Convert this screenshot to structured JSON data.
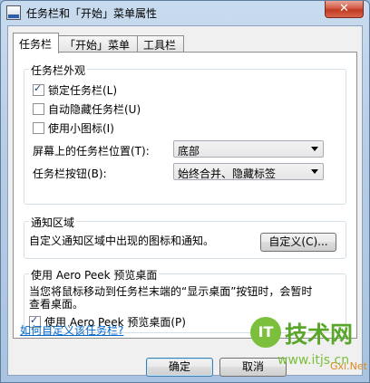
{
  "window": {
    "title": "任务栏和「开始」菜单属性",
    "close_label": "✕"
  },
  "tabs": [
    {
      "label": "任务栏",
      "active": true
    },
    {
      "label": "「开始」菜单",
      "active": false
    },
    {
      "label": "工具栏",
      "active": false
    }
  ],
  "appearance": {
    "group_label": "任务栏外观",
    "lock_taskbar": {
      "label": "锁定任务栏(L)",
      "checked": true
    },
    "autohide": {
      "label": "自动隐藏任务栏(U)",
      "checked": false
    },
    "small_icons": {
      "label": "使用小图标(I)",
      "checked": false
    },
    "location_label": "屏幕上的任务栏位置(T):",
    "location_value": "底部",
    "buttons_label": "任务栏按钮(B):",
    "buttons_value": "始终合并、隐藏标签"
  },
  "notification": {
    "group_label": "通知区域",
    "description": "自定义通知区域中出现的图标和通知。",
    "customize_button": "自定义(C)..."
  },
  "aero_peek": {
    "group_label": "使用 Aero Peek 预览桌面",
    "description_line1": "当您将鼠标移动到任务栏末端的“显示桌面”按钮时，会暂时",
    "description_line2": "查看桌面。",
    "checkbox": {
      "label": "使用 Aero Peek 预览桌面(P)",
      "checked": true
    }
  },
  "help_link": "如何自定义该任务栏?",
  "footer": {
    "ok": "确定",
    "cancel": "取消"
  },
  "watermark": {
    "logo": "IT",
    "text": "技术网",
    "url": "www.itjs.cn",
    "url2": "Gxl.Net"
  }
}
